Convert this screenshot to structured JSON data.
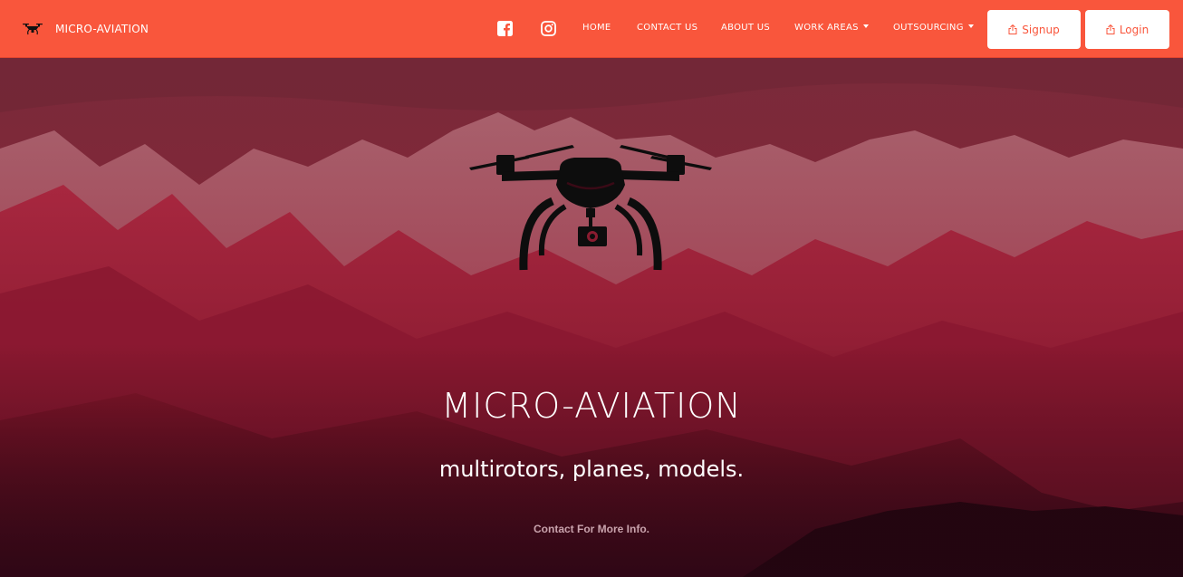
{
  "brand": {
    "name": "MICRO-AVIATION",
    "icon": "drone-icon"
  },
  "social": [
    {
      "name": "facebook",
      "icon": "facebook-icon"
    },
    {
      "name": "instagram",
      "icon": "instagram-icon"
    }
  ],
  "nav": {
    "home": "HOME",
    "contact": "CONTACT US",
    "about": "ABOUT US",
    "work_areas": "WORK AREAS",
    "outsourcing": "OUTSOURCING"
  },
  "buttons": {
    "signup": "Signup",
    "login": "Login",
    "icon": "share-icon"
  },
  "hero": {
    "title": "MICRO-AVIATION",
    "subtitle": "multirotors, planes, models.",
    "contact": "Contact For More Info."
  },
  "colors": {
    "navbar": "#f9563c",
    "hero_tint": "#9c1c33",
    "button_text": "#f9563c"
  }
}
